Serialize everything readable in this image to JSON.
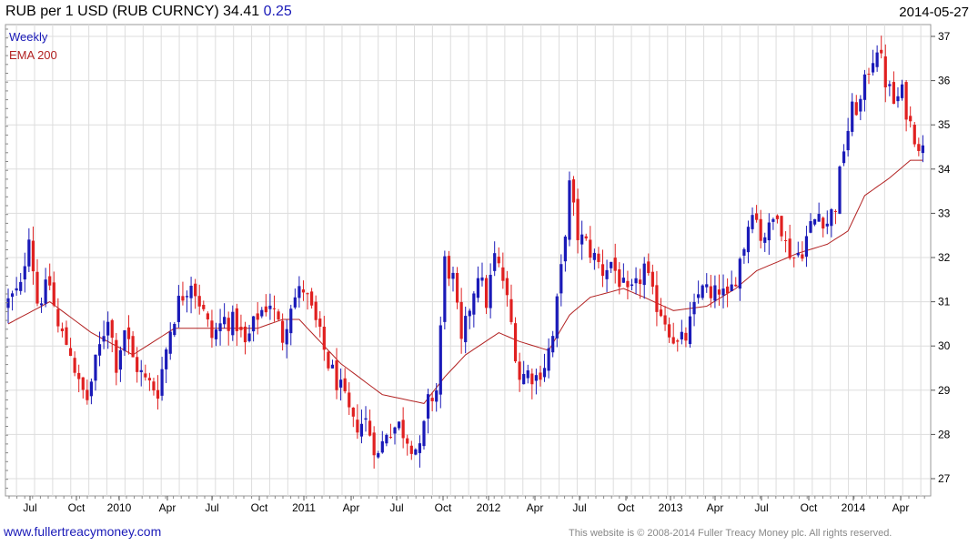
{
  "header": {
    "symbol_text": "RUB per 1 USD (RUB CURNCY)",
    "last_value": "34.41",
    "change": "0.25",
    "date": "2014-05-27"
  },
  "footer": {
    "link_text": "www.fullertreacymoney.com",
    "copyright": "This website is © 2008-2014 Fuller Treacy Money plc. All rights reserved."
  },
  "colors": {
    "up": "#1a1ab8",
    "down": "#e02020",
    "ema": "#b22222",
    "grid": "#dddddd"
  },
  "chart_data": {
    "type": "candlestick",
    "title": "RUB per 1 USD (RUB CURNCY)",
    "period": "Weekly",
    "ylim": [
      26.8,
      37.2
    ],
    "y_ticks": [
      27,
      28,
      29,
      30,
      31,
      32,
      33,
      34,
      35,
      36,
      37
    ],
    "x_ticks": [
      "Jul",
      "Oct",
      "2010",
      "Apr",
      "Jul",
      "Oct",
      "2011",
      "Apr",
      "Jul",
      "Oct",
      "2012",
      "Apr",
      "Jul",
      "Oct",
      "2013",
      "Apr",
      "Jul",
      "Oct",
      "2014",
      "Apr"
    ],
    "legend": [
      {
        "name": "Weekly",
        "color": "#1a1ab8"
      },
      {
        "name": "EMA 200",
        "color": "#b22222"
      }
    ],
    "close_anchors": [
      [
        0,
        31.0
      ],
      [
        3,
        31.3
      ],
      [
        5,
        32.6
      ],
      [
        7,
        31.0
      ],
      [
        10,
        31.4
      ],
      [
        12,
        30.4
      ],
      [
        15,
        29.9
      ],
      [
        17,
        29.1
      ],
      [
        19,
        28.8
      ],
      [
        21,
        29.6
      ],
      [
        24,
        30.7
      ],
      [
        26,
        29.6
      ],
      [
        28,
        30.4
      ],
      [
        30,
        29.7
      ],
      [
        33,
        29.2
      ],
      [
        36,
        29.0
      ],
      [
        39,
        30.4
      ],
      [
        41,
        31.0
      ],
      [
        44,
        31.5
      ],
      [
        46,
        31.0
      ],
      [
        49,
        30.2
      ],
      [
        52,
        30.6
      ],
      [
        55,
        30.5
      ],
      [
        57,
        30.0
      ],
      [
        60,
        30.7
      ],
      [
        63,
        31.0
      ],
      [
        66,
        30.2
      ],
      [
        68,
        31.0
      ],
      [
        71,
        31.3
      ],
      [
        74,
        30.5
      ],
      [
        77,
        29.6
      ],
      [
        80,
        29.0
      ],
      [
        83,
        28.2
      ],
      [
        86,
        28.3
      ],
      [
        89,
        27.5
      ],
      [
        91,
        28.1
      ],
      [
        94,
        28.2
      ],
      [
        97,
        27.8
      ],
      [
        99,
        27.6
      ],
      [
        101,
        28.7
      ],
      [
        103,
        29.0
      ],
      [
        105,
        31.9
      ],
      [
        107,
        31.5
      ],
      [
        109,
        30.0
      ],
      [
        111,
        30.9
      ],
      [
        113,
        31.7
      ],
      [
        115,
        31.0
      ],
      [
        117,
        32.0
      ],
      [
        119,
        31.5
      ],
      [
        121,
        30.5
      ],
      [
        123,
        29.3
      ],
      [
        125,
        29.4
      ],
      [
        127,
        29.3
      ],
      [
        129,
        29.6
      ],
      [
        131,
        30.2
      ],
      [
        133,
        31.7
      ],
      [
        135,
        33.6
      ],
      [
        137,
        32.5
      ],
      [
        139,
        32.3
      ],
      [
        141,
        32.0
      ],
      [
        143,
        31.7
      ],
      [
        145,
        31.9
      ],
      [
        147,
        31.5
      ],
      [
        149,
        31.1
      ],
      [
        151,
        31.3
      ],
      [
        153,
        31.8
      ],
      [
        155,
        31.1
      ],
      [
        157,
        30.8
      ],
      [
        159,
        30.4
      ],
      [
        161,
        30.0
      ],
      [
        163,
        30.2
      ],
      [
        165,
        30.8
      ],
      [
        167,
        31.5
      ],
      [
        169,
        31.0
      ],
      [
        171,
        31.3
      ],
      [
        173,
        31.0
      ],
      [
        175,
        31.6
      ],
      [
        177,
        32.3
      ],
      [
        179,
        33.2
      ],
      [
        181,
        32.5
      ],
      [
        183,
        32.6
      ],
      [
        185,
        33.1
      ],
      [
        187,
        32.3
      ],
      [
        189,
        32.0
      ],
      [
        191,
        32.2
      ],
      [
        193,
        32.7
      ],
      [
        195,
        33.0
      ],
      [
        197,
        32.8
      ],
      [
        199,
        33.2
      ],
      [
        201,
        34.5
      ],
      [
        203,
        35.3
      ],
      [
        205,
        35.5
      ],
      [
        207,
        36.3
      ],
      [
        209,
        36.8
      ],
      [
        211,
        36.0
      ],
      [
        213,
        35.5
      ],
      [
        215,
        35.7
      ],
      [
        217,
        35.0
      ],
      [
        219,
        34.6
      ],
      [
        220,
        34.41
      ]
    ],
    "ema_anchors": [
      [
        0,
        30.5
      ],
      [
        10,
        31.0
      ],
      [
        20,
        30.3
      ],
      [
        30,
        29.8
      ],
      [
        40,
        30.4
      ],
      [
        50,
        30.4
      ],
      [
        60,
        30.4
      ],
      [
        66,
        30.6
      ],
      [
        70,
        30.6
      ],
      [
        80,
        29.6
      ],
      [
        90,
        28.9
      ],
      [
        100,
        28.7
      ],
      [
        105,
        29.3
      ],
      [
        110,
        29.8
      ],
      [
        118,
        30.3
      ],
      [
        123,
        30.1
      ],
      [
        130,
        29.9
      ],
      [
        135,
        30.7
      ],
      [
        140,
        31.1
      ],
      [
        148,
        31.3
      ],
      [
        153,
        31.1
      ],
      [
        160,
        30.8
      ],
      [
        168,
        30.9
      ],
      [
        175,
        31.3
      ],
      [
        180,
        31.7
      ],
      [
        190,
        32.1
      ],
      [
        197,
        32.3
      ],
      [
        202,
        32.6
      ],
      [
        206,
        33.4
      ],
      [
        212,
        33.8
      ],
      [
        217,
        34.2
      ],
      [
        220,
        34.2
      ]
    ]
  }
}
